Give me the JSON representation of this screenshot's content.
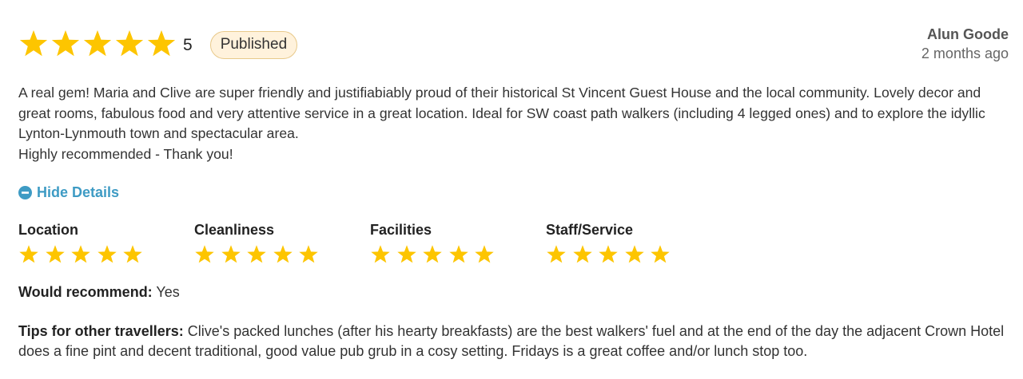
{
  "review": {
    "rating": {
      "stars_filled": 5,
      "stars_total": 5,
      "value": "5"
    },
    "status_badge": "Published",
    "author": {
      "name": "Alun Goode",
      "time_ago": "2 months ago"
    },
    "body": [
      "A real gem!  Maria and Clive are super friendly and justifiabiably proud of their historical St Vincent Guest House and the local community.  Lovely decor and great rooms, fabulous food and very attentive service in a great location.  Ideal for SW coast path walkers (including 4 legged ones) and to explore the idyllic Lynton-Lynmouth town and spectacular area.",
      "Highly recommended -  Thank you!"
    ],
    "details_toggle": {
      "label": "Hide Details",
      "icon": "minus-circle-icon"
    },
    "categories": [
      {
        "label": "Location",
        "stars_filled": 5,
        "stars_total": 5
      },
      {
        "label": "Cleanliness",
        "stars_filled": 5,
        "stars_total": 5
      },
      {
        "label": "Facilities",
        "stars_filled": 5,
        "stars_total": 5
      },
      {
        "label": "Staff/Service",
        "stars_filled": 5,
        "stars_total": 5
      }
    ],
    "would_recommend": {
      "label": "Would recommend:",
      "value": "Yes"
    },
    "tips": {
      "label": "Tips for other travellers:",
      "text": "Clive's packed lunches (after his hearty breakfasts) are the best walkers' fuel and at the end of the day the adjacent Crown Hotel does a fine pint and decent traditional, good value pub grub in a cosy setting. Fridays is a great coffee and/or lunch stop too."
    }
  },
  "colors": {
    "star": "#fdc500",
    "accent": "#3e9bc4",
    "badge_bg": "#fff2dc",
    "badge_border": "#e8c98a"
  }
}
